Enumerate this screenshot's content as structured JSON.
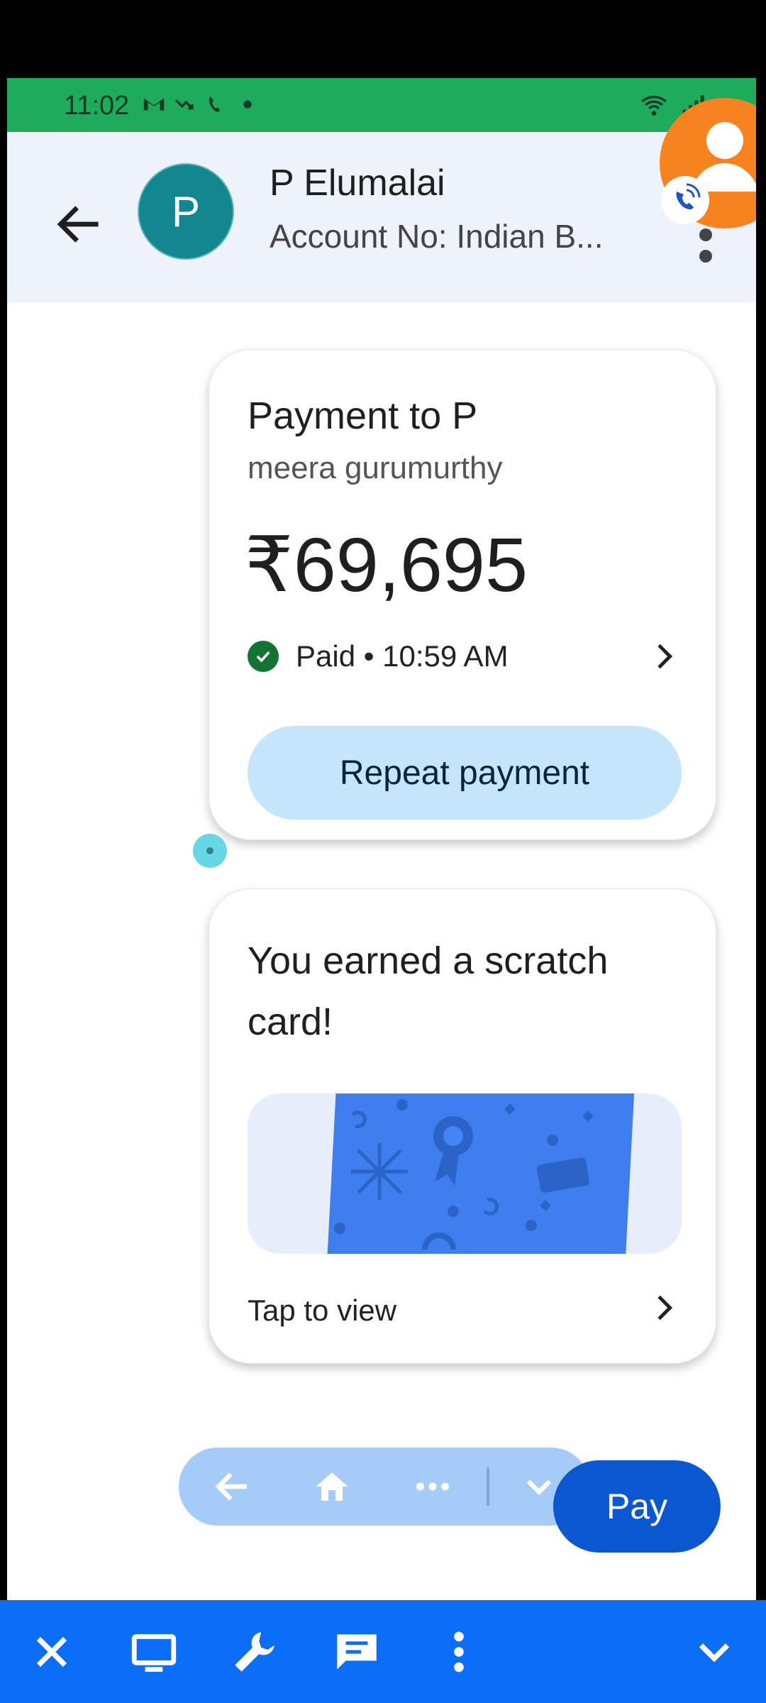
{
  "status_bar": {
    "time": "11:02"
  },
  "header": {
    "avatar_letter": "P",
    "contact_name": "P Elumalai",
    "account_line": "Account No: Indian B..."
  },
  "payment_card": {
    "title": "Payment to P",
    "subtitle": "meera gurumurthy",
    "amount": "₹69,695",
    "status": "Paid • 10:59 AM",
    "repeat_label": "Repeat payment"
  },
  "scratch_card": {
    "title": "You earned a scratch card!",
    "tap_label": "Tap to view"
  },
  "pay_button": {
    "label": "Pay"
  },
  "colors": {
    "status_bar": "#1eab5b",
    "header_bg": "#eef2fa",
    "avatar": "#13878f",
    "repeat_bg": "#c5e5fc",
    "pay_bg": "#0b57d0",
    "bottom_toolbar": "#0c6ef7",
    "paid_check": "#137333"
  },
  "icons": {
    "header": [
      "back-arrow-icon",
      "more-vert-icon",
      "floating-call-bubble-icon"
    ],
    "floating_nav": [
      "nav-back-icon",
      "home-icon",
      "more-horiz-icon",
      "chevron-down-icon"
    ],
    "bottom_toolbar": [
      "close-icon",
      "monitor-icon",
      "wrench-icon",
      "chat-icon",
      "more-vert-icon",
      "chevron-down-icon"
    ]
  }
}
